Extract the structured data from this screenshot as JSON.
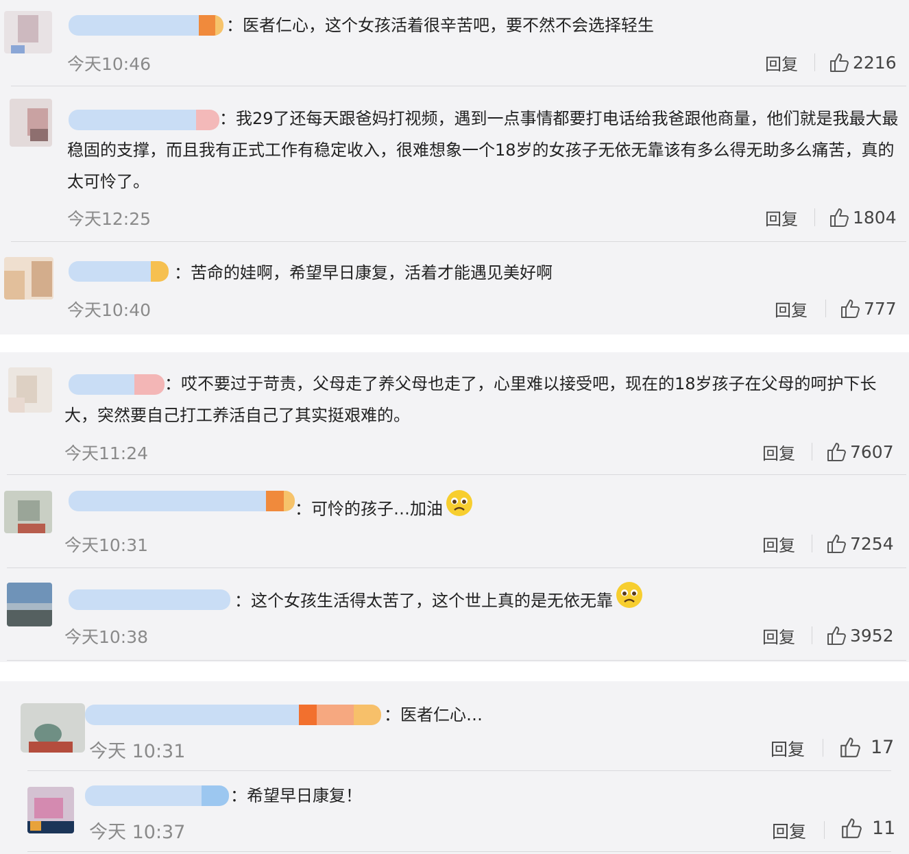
{
  "comments": [
    {
      "text": "：医者仁心，这个女孩活着很辛苦吧，要不然不会选择轻生",
      "time": "今天10:46",
      "reply": "回复",
      "likes": "2216"
    },
    {
      "text": "：我29了还每天跟爸妈打视频，遇到一点事情都要打电话给我爸跟他商量，他们就是我最大最稳固的支撑，而且我有正式工作有稳定收入，很难想象一个18岁的女孩子无依无靠该有多么得无助多么痛苦，真的太可怜了。",
      "time": "今天12:25",
      "reply": "回复",
      "likes": "1804"
    },
    {
      "text": "：苦命的娃啊，希望早日康复，活着才能遇见美好啊",
      "time": "今天10:40",
      "reply": "回复",
      "likes": "777"
    },
    {
      "text": "：哎不要过于苛责，父母走了养父母也走了，心里难以接受吧，现在的18岁孩子在父母的呵护下长大，突然要自己打工养活自己了其实挺艰难的。",
      "time": "今天11:24",
      "reply": "回复",
      "likes": "7607"
    },
    {
      "text": "：可怜的孩子…加油",
      "emoji": "sad-face-emoji",
      "time": "今天10:31",
      "reply": "回复",
      "likes": "7254"
    },
    {
      "text": "：这个女孩生活得太苦了，这个世上真的是无依无靠",
      "emoji": "sad-face-emoji",
      "time": "今天10:38",
      "reply": "回复",
      "likes": "3952"
    },
    {
      "text": "：医者仁心…",
      "time": "今天 10:31",
      "reply": "回复",
      "likes": "17"
    },
    {
      "text": "：希望早日康复！",
      "time": "今天 10:37",
      "reply": "回复",
      "likes": "11"
    }
  ],
  "icons": {
    "like": "thumbs-up-icon"
  },
  "colors": {
    "background": "#f3f3f5",
    "username_blur": "#c9ddf5",
    "vip_badge": "#f08a3c"
  }
}
